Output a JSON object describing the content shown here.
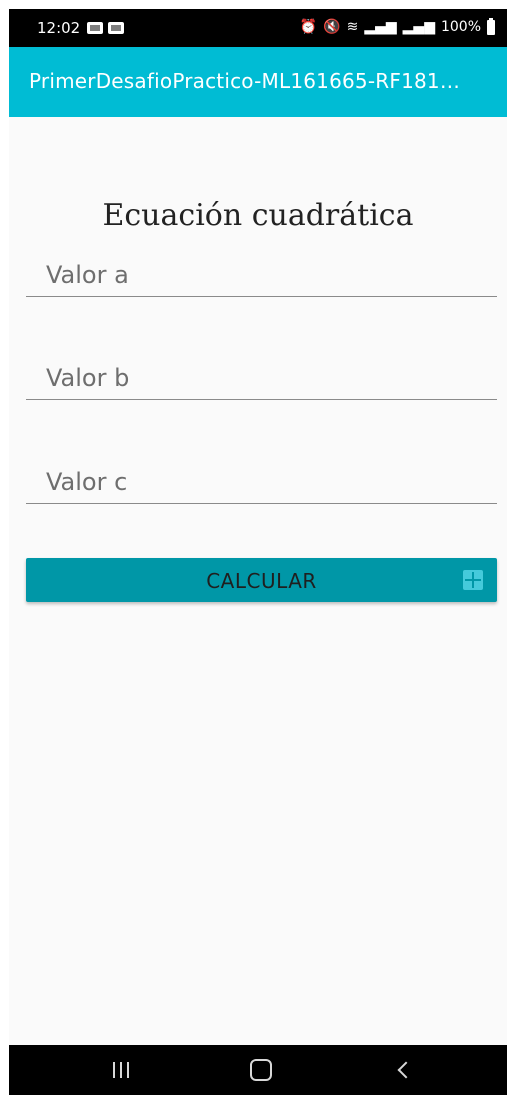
{
  "status_bar": {
    "time": "12:02",
    "battery": "100%",
    "icons": [
      "notification-icon",
      "notification-icon",
      "alarm-icon",
      "mute-icon",
      "wifi-icon",
      "signal-icon",
      "signal-icon",
      "battery-icon"
    ]
  },
  "app_bar": {
    "title": "PrimerDesafioPractico-ML161665-RF181…",
    "color": "#00bcd4"
  },
  "main": {
    "heading": "Ecuación cuadrática",
    "fields": {
      "a": {
        "placeholder": "Valor a",
        "value": ""
      },
      "b": {
        "placeholder": "Valor b",
        "value": ""
      },
      "c": {
        "placeholder": "Valor c",
        "value": ""
      }
    },
    "calculate_button": {
      "label": "CALCULAR",
      "icon": "calculator-icon",
      "color": "#0097a7"
    }
  },
  "nav_bar": {
    "buttons": [
      "recent-apps-icon",
      "home-icon",
      "back-icon"
    ]
  }
}
